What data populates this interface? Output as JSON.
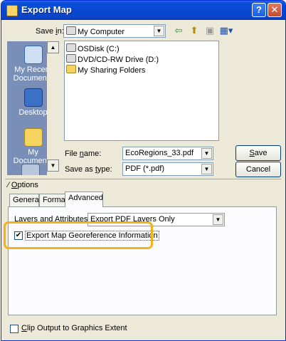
{
  "window": {
    "title": "Export Map",
    "help_label": "?",
    "close_label": "✕"
  },
  "save_in": {
    "label_pre": "Save ",
    "label_u": "i",
    "label_post": "n:",
    "value": "My Computer"
  },
  "toolbar": {
    "back_icon": "⇦",
    "up_icon": "⬆",
    "new_folder_icon": "▣",
    "views_icon": "▦▾"
  },
  "places": [
    {
      "label": "My Recent Documents"
    },
    {
      "label": "Desktop"
    },
    {
      "label": "My Documents"
    }
  ],
  "files": [
    {
      "name": "OSDisk (C:)"
    },
    {
      "name": "DVD/CD-RW Drive (D:)"
    },
    {
      "name": "My Sharing Folders"
    }
  ],
  "file_name": {
    "label_pre": "File ",
    "label_u": "n",
    "label_post": "ame:",
    "value": "EcoRegions_33.pdf"
  },
  "save_as_type": {
    "label_pre": "Save as ",
    "label_u": "t",
    "label_post": "ype:",
    "value": "PDF (*.pdf)"
  },
  "buttons": {
    "save_u": "S",
    "save_rest": "ave",
    "cancel": "Cancel"
  },
  "options": {
    "label_u": "O",
    "label_rest": "ptions",
    "collapse_icon": "⁄"
  },
  "tabs": [
    "General",
    "Format",
    "Advanced"
  ],
  "advanced": {
    "layers_label": "Layers and Attributes:",
    "layers_value": "Export PDF Layers Only",
    "georef_label": "Export Map Georeference Information",
    "georef_checked": "✔"
  },
  "clip": {
    "label_pre": "",
    "label_u": "C",
    "label_post": "lip Output to Graphics Extent"
  },
  "scroll": {
    "up": "▲",
    "down": "▼"
  },
  "combo_arrow": "▼"
}
